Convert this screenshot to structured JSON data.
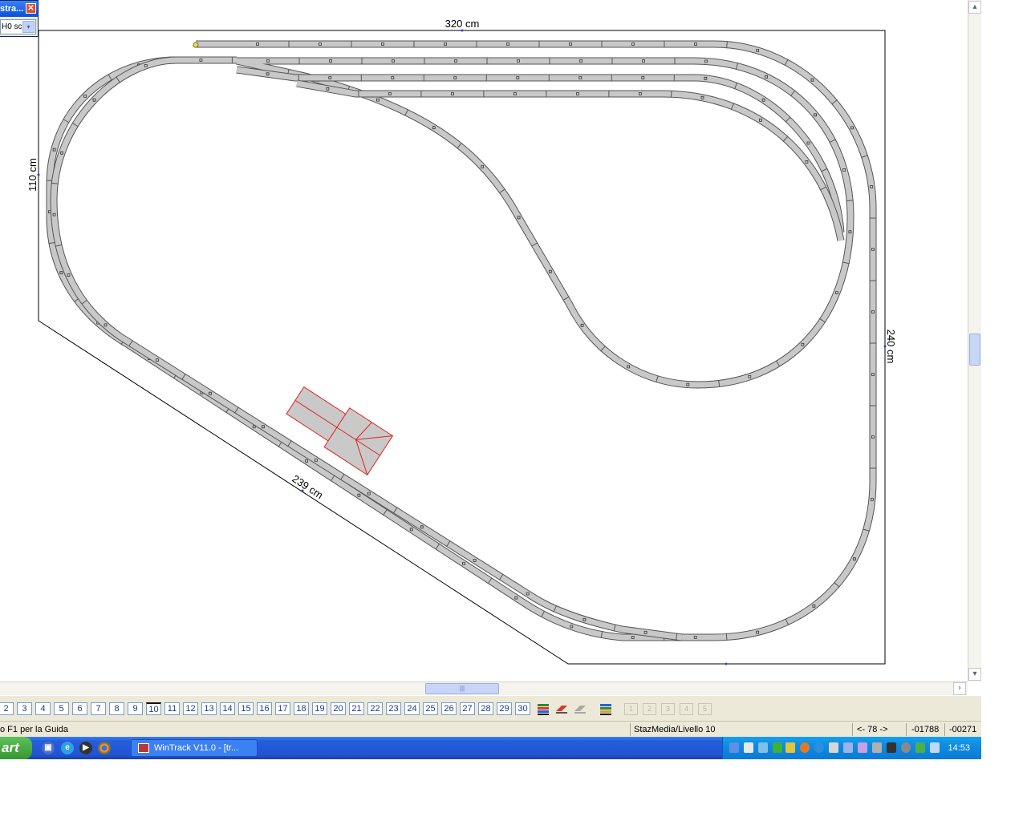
{
  "layout": {
    "dim_top": "320 cm",
    "dim_left": "110 cm",
    "dim_right": "240 cm",
    "dim_diag": "239 cm"
  },
  "palette": {
    "rail_fill": "#c8c8c8",
    "rail_edge": "#555555",
    "building_fill": "#c9c9c9",
    "building_edge": "#e0241c",
    "measure_line": "#000000"
  },
  "floating_panel": {
    "title": "stra...",
    "close_glyph": "✕",
    "scale_value": "H0 sc",
    "dropdown_glyph": "▾"
  },
  "scrollbars": {
    "up": "▴",
    "down": "▾",
    "right": "›",
    "grip": "|||"
  },
  "toolbar": {
    "levels": [
      "2",
      "3",
      "4",
      "5",
      "6",
      "7",
      "8",
      "9",
      "10",
      "11",
      "12",
      "13",
      "14",
      "15",
      "16",
      "17",
      "18",
      "19",
      "20",
      "21",
      "22",
      "23",
      "24",
      "25",
      "26",
      "27",
      "28",
      "29",
      "30"
    ],
    "disabled_levels": [
      "1",
      "2",
      "3",
      "4",
      "5"
    ]
  },
  "statusbar": {
    "hint": "o F1 per la Guida",
    "layer": "StazMedia/Livello 10",
    "zoom": "<- 78 ->",
    "coord_x": "-01788",
    "coord_y": "-00271"
  },
  "taskbar": {
    "start_label": "art",
    "task_label": "WinTrack  V11.0 - [tr...",
    "clock": "14:53"
  }
}
